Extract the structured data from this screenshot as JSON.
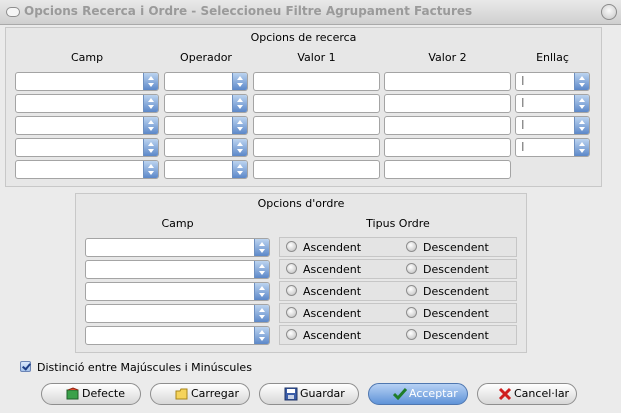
{
  "window": {
    "title": "Opcions Recerca i Ordre - Seleccioneu Filtre Agrupament Factures"
  },
  "search_panel": {
    "title": "Opcions de recerca",
    "headers": {
      "field": "Camp",
      "operator": "Operador",
      "value1": "Valor 1",
      "value2": "Valor 2",
      "link": "Enllaç"
    },
    "link_values": [
      "I",
      "I",
      "I",
      "I"
    ]
  },
  "order_panel": {
    "title": "Opcions d'ordre",
    "headers": {
      "field": "Camp",
      "order_type": "Tipus Ordre"
    },
    "rows": [
      {
        "asc": "Ascendent",
        "desc": "Descendent"
      },
      {
        "asc": "Ascendent",
        "desc": "Descendent"
      },
      {
        "asc": "Ascendent",
        "desc": "Descendent"
      },
      {
        "asc": "Ascendent",
        "desc": "Descendent"
      },
      {
        "asc": "Ascendent",
        "desc": "Descendent"
      }
    ]
  },
  "case_checkbox": {
    "label": "Distinció entre Majúscules i Minúscules",
    "checked": true
  },
  "buttons": {
    "defaults": "Defecte",
    "load": "Carregar",
    "save": "Guardar",
    "accept": "Acceptar",
    "cancel": "Cancel·lar"
  },
  "colors": {
    "accent": "#5f93d8",
    "arrow": "#5c88c9"
  }
}
